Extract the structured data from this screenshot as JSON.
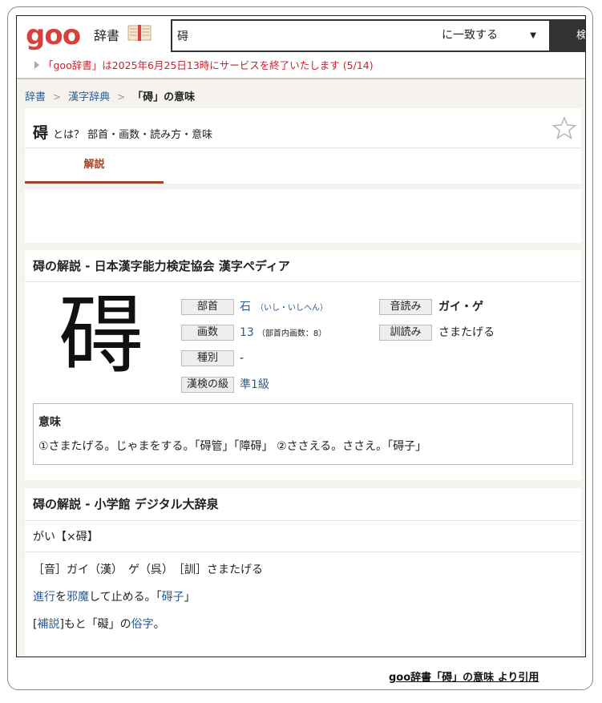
{
  "header": {
    "logo": "goo",
    "dict_label": "辞書",
    "search_value": "碍",
    "match_mode": "に一致する",
    "search_button": "検",
    "notice": "「goo辞書」は2025年6月25日13時にサービスを終了いたします (5/14)"
  },
  "breadcrumb": {
    "item1": "辞書",
    "item2": "漢字辞典",
    "current": "「碍」の意味"
  },
  "title": {
    "kanji": "碍",
    "suffix": "とは？ 部首・画数・読み方・意味"
  },
  "tabs": {
    "active": "解説"
  },
  "kanken": {
    "heading": "碍の解説 - 日本漢字能力検定協会 漢字ペディア",
    "big_kanji": "碍",
    "bushu_label": "部首",
    "bushu_value": "石",
    "bushu_reading": "（いし・いしへん）",
    "kakusu_label": "画数",
    "kakusu_value": "13",
    "kakusu_note": "（部首内画数：8）",
    "shubetsu_label": "種別",
    "shubetsu_value": "-",
    "kyu_label": "漢検の級",
    "kyu_value": "準1級",
    "on_label": "音読み",
    "on_value": "ガイ・ゲ",
    "kun_label": "訓読み",
    "kun_value": "さまたげる",
    "meaning_title": "意味",
    "meaning_text": "①さまたげる。じゃまをする。「碍管」「障碍」 ②ささえる。ささえ。「碍子」"
  },
  "daijisen": {
    "heading": "碍の解説 - 小学館 デジタル大辞泉",
    "entry": "がい【×碍】",
    "readings": "［音］ガイ（漢）　ゲ（呉）　［訓］さまたげる",
    "def_link1": "進行",
    "def_mid1": "を",
    "def_link2": "邪魔",
    "def_mid2": "して止める。「",
    "def_link3": "碍子",
    "def_end": "」",
    "note_open": "[",
    "note_link": "補説",
    "note_mid": "]もと「礙」の",
    "note_link2": "俗字",
    "note_end": "。"
  },
  "credit": "goo辞書「碍」の意味  より引用",
  "colors": {
    "logo_red": "#d8403e",
    "link_blue": "#2a5b97",
    "tab_accent": "#a0452a",
    "notice_red": "#d0202c"
  }
}
